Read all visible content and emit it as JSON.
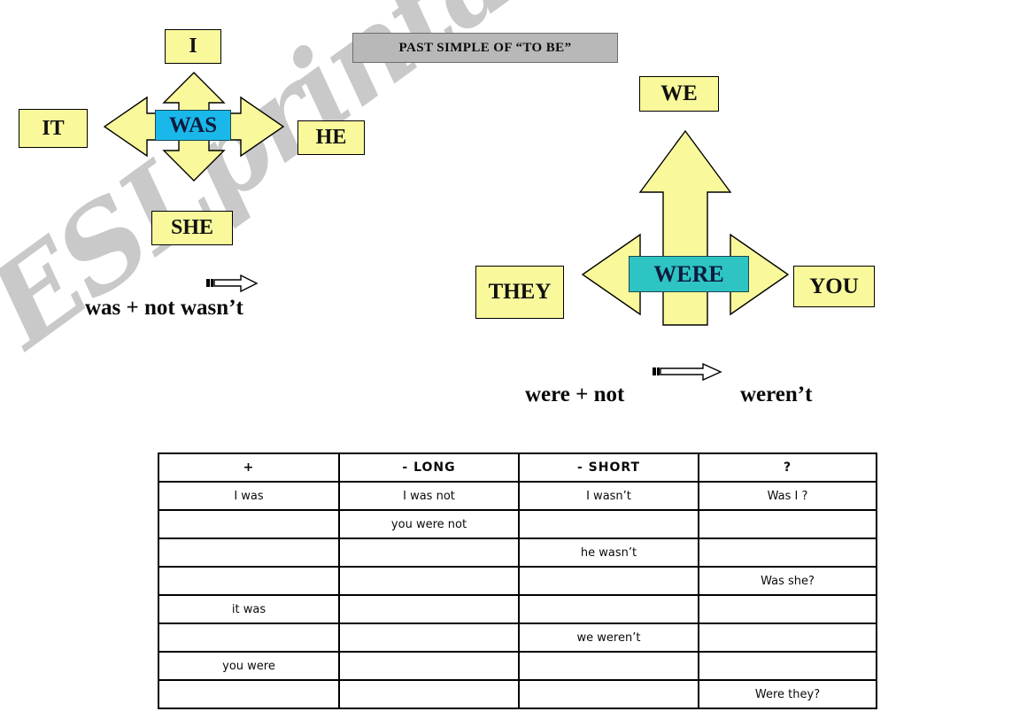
{
  "title": {
    "text": "PAST SIMPLE OF “TO BE”"
  },
  "watermark": {
    "text": "ESLprintables.com"
  },
  "was_group": {
    "verb": "WAS",
    "verb_color": "#1ab8ea",
    "pronouns": {
      "top": "I",
      "left": "IT",
      "right": "HE",
      "bottom": "SHE"
    }
  },
  "were_group": {
    "verb": "WERE",
    "verb_color": "#2ec4c4",
    "pronouns": {
      "top": "WE",
      "left": "THEY",
      "right": "YOU"
    }
  },
  "formulas": {
    "was_rule": "was + not  wasn’t",
    "were_rule_left": "were + not",
    "were_rule_right": "weren’t"
  },
  "colors": {
    "box_fill": "#f9f99c",
    "box_border": "#000000",
    "arrow_fill": "#f9f99c",
    "title_fill": "#b8b8b8",
    "watermark": "#c9c9c9"
  },
  "table": {
    "headers": [
      "+",
      "-   LONG",
      "-   SHORT",
      "?"
    ],
    "rows": [
      [
        "I was",
        "I was not",
        "I wasn’t",
        "Was I ?"
      ],
      [
        "",
        "you were not",
        "",
        ""
      ],
      [
        "",
        "",
        "he wasn’t",
        ""
      ],
      [
        "",
        "",
        "",
        "Was she?"
      ],
      [
        "it was",
        "",
        "",
        ""
      ],
      [
        "",
        "",
        "we weren’t",
        ""
      ],
      [
        "you were",
        "",
        "",
        ""
      ],
      [
        "",
        "",
        "",
        "Were they?"
      ]
    ]
  }
}
